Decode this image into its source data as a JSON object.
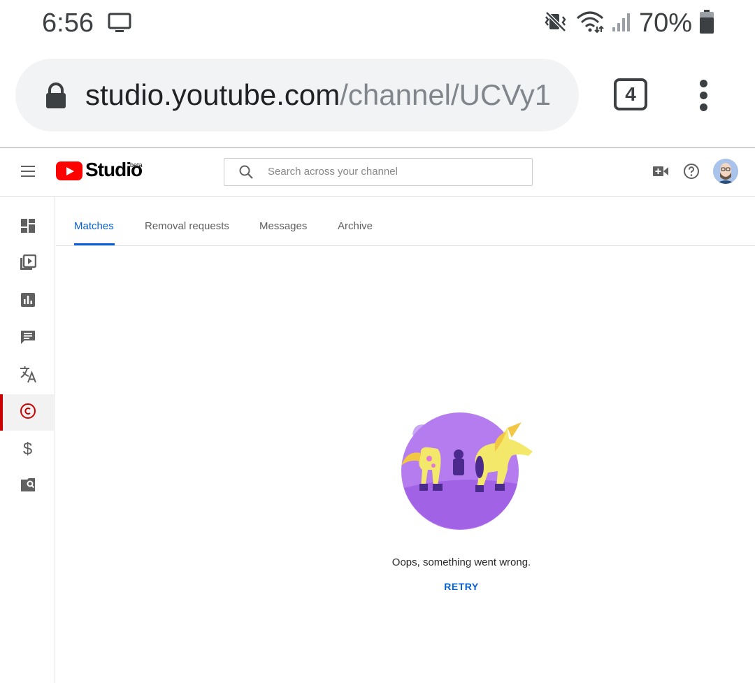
{
  "status_bar": {
    "time": "6:56",
    "battery_percent": "70%",
    "icons": [
      "cast-icon",
      "vibrate-icon",
      "wifi-icon",
      "signal-icon",
      "battery-icon"
    ]
  },
  "browser": {
    "url_host": "studio.youtube.com",
    "url_path": "/channel/UCVy1",
    "tab_count": "4"
  },
  "studio": {
    "brand": "Studio",
    "beta_label": "beta",
    "search_placeholder": "Search across your channel"
  },
  "tabs": [
    {
      "label": "Matches",
      "active": true
    },
    {
      "label": "Removal requests",
      "active": false
    },
    {
      "label": "Messages",
      "active": false
    },
    {
      "label": "Archive",
      "active": false
    }
  ],
  "left_nav": [
    {
      "icon": "dashboard-icon"
    },
    {
      "icon": "videos-icon"
    },
    {
      "icon": "analytics-icon"
    },
    {
      "icon": "comments-icon"
    },
    {
      "icon": "translations-icon"
    },
    {
      "icon": "copyright-icon",
      "active": true
    },
    {
      "icon": "monetization-icon",
      "glyph": "$"
    },
    {
      "icon": "audio-library-icon"
    }
  ],
  "error": {
    "message": "Oops, something went wrong.",
    "retry_label": "RETRY"
  },
  "colors": {
    "accent_blue": "#065fd4",
    "youtube_red": "#ff0000",
    "active_nav": "#cc0000",
    "illustration_purple": "#b57cf0",
    "illustration_yellow": "#f4e86a"
  }
}
